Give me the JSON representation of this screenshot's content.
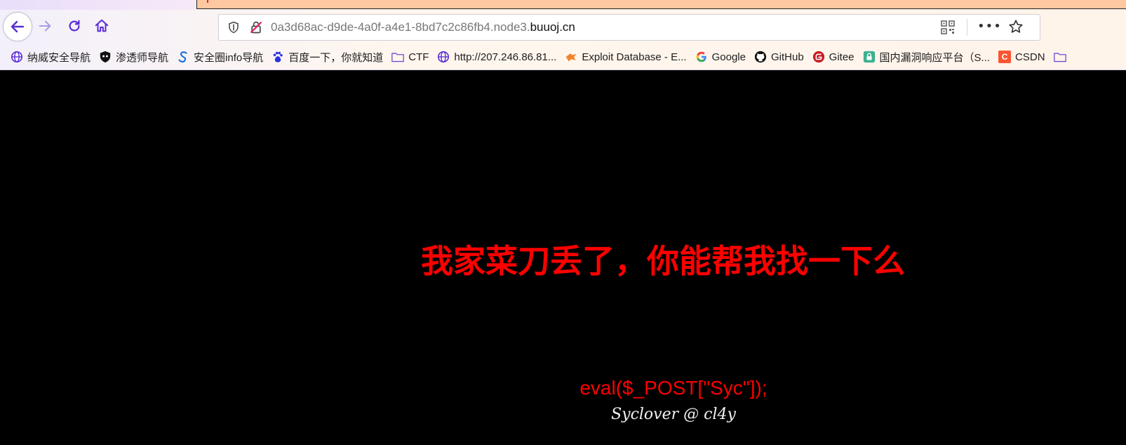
{
  "browser": {
    "url_host": "0a3d68ac-d9de-4a0f-a4e1-8bd7c2c86fb4.node3.",
    "url_domain": "buuoj.cn",
    "icons": {
      "back": "arrow-left-icon",
      "forward": "arrow-right-icon",
      "reload": "reload-icon",
      "home": "home-icon",
      "shield": "tracking-shield-icon",
      "insecure": "insecure-lock-icon",
      "qr": "qr-code-icon",
      "more": "more-actions-icon",
      "bookmark_star": "star-icon"
    },
    "more_label": "•••"
  },
  "bookmarks": [
    {
      "label": "纳威安全导航",
      "icon": "globe-icon"
    },
    {
      "label": "渗透师导航",
      "icon": "shield-skull-icon"
    },
    {
      "label": "安全圈info导航",
      "icon": "s-logo-icon"
    },
    {
      "label": "百度一下，你就知道",
      "icon": "baidu-paw-icon"
    },
    {
      "label": "CTF",
      "icon": "folder-icon"
    },
    {
      "label": "http://207.246.86.81...",
      "icon": "globe-icon"
    },
    {
      "label": "Exploit Database - E...",
      "icon": "exploit-db-icon"
    },
    {
      "label": "Google",
      "icon": "google-g-icon"
    },
    {
      "label": "GitHub",
      "icon": "github-icon"
    },
    {
      "label": "Gitee",
      "icon": "gitee-icon"
    },
    {
      "label": "国内漏洞响应平台（S...",
      "icon": "lock-badge-icon"
    },
    {
      "label": "CSDN",
      "icon": "csdn-icon"
    }
  ],
  "page": {
    "heading": "我家菜刀丢了，你能帮我找一下么",
    "code": "eval($_POST[\"Syc\"]);",
    "credit": "Syclover @ cl4y"
  },
  "colors": {
    "background": "#000000",
    "heading": "#ff0000",
    "code": "#ff0000",
    "credit": "#f2f2f2",
    "nav_icon": "#5a2bd6",
    "active_tab": "#ffc8a0"
  }
}
